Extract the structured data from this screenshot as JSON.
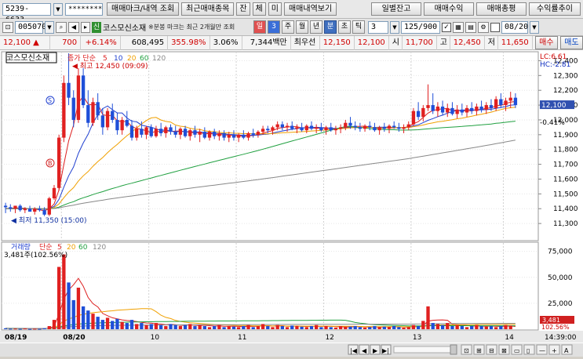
{
  "toolbar": {
    "account": "5239-6633",
    "password": "********",
    "buttons": [
      "매매마크/내역 조회",
      "최근매매종목",
      "잔",
      "체",
      "미",
      "매매내역보기"
    ],
    "right_buttons": [
      "일별잔고",
      "매매수익",
      "매매총평",
      "수익률추이"
    ]
  },
  "toolbar2": {
    "code": "005070",
    "name_tag": "신",
    "stock_name": "코스모신소재",
    "notice": "※분봉 마크는 최근 2개월만 조회",
    "periods": [
      "일",
      "3",
      "주",
      "월",
      "년",
      "분",
      "초",
      "틱"
    ],
    "selected_period": "분",
    "minute_value": "3",
    "count": "125/900",
    "date": "08/20"
  },
  "quote": {
    "price": "12,100",
    "change": "700",
    "change_pct": "+6.14%",
    "volume": "608,495",
    "vol_ratio": "355.98%",
    "turnover_pct": "3.06%",
    "amount": "7,344백만",
    "best_label": "최우선",
    "best_ask": "12,150",
    "best_bid": "12,100",
    "open_label": "시",
    "open": "11,700",
    "high_label": "고",
    "high": "12,450",
    "low_label": "저",
    "low": "11,650",
    "buy_button": "매수",
    "sell_button": "매도"
  },
  "chart_data": {
    "type": "candlestick",
    "price_panel": {
      "title": "코스모신소재",
      "ma_label": "종가 단순",
      "ma_periods": [
        "5",
        "10",
        "20",
        "60",
        "120"
      ],
      "ma_colors": [
        "#dd2020",
        "#2040d0",
        "#f0a000",
        "#20a040",
        "#888888"
      ],
      "ylim": [
        11200,
        12450
      ],
      "yticks": [
        "12,400",
        "12,300",
        "12,200",
        "12,100",
        "12,000",
        "11,900",
        "11,800",
        "11,700",
        "11,600",
        "11,500",
        "11,400",
        "11,300"
      ],
      "high_annotation": "최고 12,450 (09:09)",
      "low_annotation": "최저 11,350 (15:00)",
      "current_price": "12,100",
      "lc": "LC:6.61",
      "hc": "HC:-2.81",
      "pct_label": "-0.41%",
      "marks": [
        "S",
        "B"
      ]
    },
    "volume_panel": {
      "title": "거래량",
      "ma_label": "단순",
      "ma_periods": [
        "5",
        "20",
        "60",
        "120"
      ],
      "current_label": "3,481주(102.56%)",
      "yticks": [
        "75,000",
        "50,000",
        "25,000"
      ],
      "current_value": "3,481",
      "current_pct": "102.56%"
    },
    "x_labels": [
      "08/19",
      "08/20",
      "10",
      "11",
      "12",
      "13",
      "14"
    ],
    "time_label": "14:39:00",
    "candles": [
      [
        11420,
        11440,
        11370,
        11410
      ],
      [
        11410,
        11430,
        11380,
        11400
      ],
      [
        11400,
        11420,
        11370,
        11420
      ],
      [
        11420,
        11430,
        11380,
        11390
      ],
      [
        11390,
        11410,
        11370,
        11400
      ],
      [
        11400,
        11420,
        11380,
        11380
      ],
      [
        11380,
        11410,
        11360,
        11400
      ],
      [
        11400,
        11420,
        11380,
        11390
      ],
      [
        11390,
        11410,
        11350,
        11360
      ],
      [
        11360,
        11480,
        11350,
        11470
      ],
      [
        11470,
        11560,
        11460,
        11540
      ],
      [
        11540,
        11900,
        11520,
        11880
      ],
      [
        11880,
        12300,
        11850,
        12250
      ],
      [
        12250,
        12450,
        12100,
        12150
      ],
      [
        12150,
        12200,
        11950,
        12000
      ],
      [
        12000,
        12350,
        11980,
        12300
      ],
      [
        12300,
        12350,
        12080,
        12100
      ],
      [
        12100,
        12200,
        11950,
        11980
      ],
      [
        11980,
        12150,
        11960,
        12120
      ],
      [
        12120,
        12180,
        12000,
        12030
      ],
      [
        12030,
        12080,
        11900,
        11950
      ],
      [
        11950,
        12080,
        11930,
        12060
      ],
      [
        12060,
        12110,
        11980,
        12000
      ],
      [
        12000,
        12050,
        11900,
        11930
      ],
      [
        11930,
        12020,
        11900,
        12000
      ],
      [
        12000,
        12060,
        11950,
        11960
      ],
      [
        11960,
        12000,
        11860,
        11880
      ],
      [
        11880,
        11960,
        11860,
        11940
      ],
      [
        11940,
        11990,
        11880,
        11900
      ],
      [
        11900,
        11960,
        11870,
        11950
      ],
      [
        11950,
        11970,
        11880,
        11890
      ],
      [
        11890,
        11960,
        11880,
        11940
      ],
      [
        11940,
        11980,
        11890,
        11910
      ],
      [
        11910,
        11960,
        11880,
        11950
      ],
      [
        11950,
        11970,
        11900,
        11920
      ],
      [
        11920,
        11960,
        11880,
        11900
      ],
      [
        11900,
        11950,
        11870,
        11940
      ],
      [
        11940,
        11960,
        11880,
        11890
      ],
      [
        11890,
        11940,
        11860,
        11930
      ],
      [
        11930,
        11960,
        11880,
        11900
      ],
      [
        11900,
        11940,
        11850,
        11920
      ],
      [
        11920,
        11950,
        11870,
        11880
      ],
      [
        11880,
        11930,
        11860,
        11920
      ],
      [
        11920,
        11940,
        11870,
        11890
      ],
      [
        11890,
        11930,
        11860,
        11910
      ],
      [
        11910,
        11930,
        11860,
        11880
      ],
      [
        11880,
        11920,
        11850,
        11900
      ],
      [
        11900,
        11930,
        11860,
        11880
      ],
      [
        11880,
        11910,
        11850,
        11900
      ],
      [
        11900,
        11930,
        11870,
        11880
      ],
      [
        11880,
        11920,
        11860,
        11910
      ],
      [
        11910,
        11940,
        11880,
        11900
      ],
      [
        11900,
        11930,
        11880,
        11920
      ],
      [
        11920,
        11960,
        11900,
        11940
      ],
      [
        11940,
        11960,
        11910,
        11930
      ],
      [
        11930,
        11960,
        11900,
        11950
      ],
      [
        11950,
        11990,
        11930,
        11970
      ],
      [
        11970,
        11990,
        11930,
        11950
      ],
      [
        11950,
        11980,
        11920,
        11960
      ],
      [
        11960,
        11990,
        11930,
        11940
      ],
      [
        11940,
        11970,
        11910,
        11950
      ],
      [
        11950,
        11980,
        11920,
        11930
      ],
      [
        11930,
        11970,
        11910,
        11960
      ],
      [
        11960,
        11990,
        11930,
        11940
      ],
      [
        11940,
        11970,
        11910,
        11950
      ],
      [
        11950,
        11980,
        11920,
        11930
      ],
      [
        11930,
        11960,
        11900,
        11950
      ],
      [
        11950,
        11980,
        11920,
        11930
      ],
      [
        11930,
        11960,
        11900,
        11940
      ],
      [
        11940,
        11970,
        11910,
        11950
      ],
      [
        11950,
        12000,
        11930,
        11980
      ],
      [
        11980,
        12020,
        11940,
        11960
      ],
      [
        11960,
        11990,
        11930,
        11950
      ],
      [
        11950,
        11980,
        11920,
        11940
      ],
      [
        11940,
        11970,
        11920,
        11960
      ],
      [
        11960,
        11990,
        11930,
        11950
      ],
      [
        11950,
        11980,
        11920,
        11930
      ],
      [
        11930,
        11960,
        11900,
        11950
      ],
      [
        11950,
        11980,
        11920,
        11940
      ],
      [
        11940,
        11970,
        11910,
        11960
      ],
      [
        11960,
        11990,
        11940,
        11950
      ],
      [
        11950,
        11980,
        11920,
        11940
      ],
      [
        11940,
        11970,
        11910,
        11950
      ],
      [
        11950,
        11990,
        11930,
        11970
      ],
      [
        11970,
        12080,
        11960,
        12060
      ],
      [
        12060,
        12120,
        12000,
        12020
      ],
      [
        12020,
        12100,
        11990,
        12080
      ],
      [
        12080,
        12240,
        12060,
        12100
      ],
      [
        12100,
        12180,
        12040,
        12060
      ],
      [
        12060,
        12120,
        12020,
        12090
      ],
      [
        12090,
        12130,
        12030,
        12050
      ],
      [
        12050,
        12110,
        12020,
        12080
      ],
      [
        12080,
        12120,
        12030,
        12040
      ],
      [
        12040,
        12100,
        12010,
        12070
      ],
      [
        12070,
        12110,
        12030,
        12050
      ],
      [
        12050,
        12100,
        12020,
        12080
      ],
      [
        12080,
        12120,
        12040,
        12060
      ],
      [
        12060,
        12110,
        12030,
        12090
      ],
      [
        12090,
        12130,
        12050,
        12070
      ],
      [
        12070,
        12120,
        12040,
        12100
      ],
      [
        12100,
        12140,
        12060,
        12080
      ],
      [
        12080,
        12160,
        12060,
        12140
      ],
      [
        12140,
        12180,
        12080,
        12100
      ],
      [
        12100,
        12150,
        12060,
        12130
      ],
      [
        12130,
        12190,
        12080,
        12150
      ],
      [
        12150,
        12180,
        12080,
        12100
      ]
    ],
    "volumes": [
      900,
      500,
      600,
      400,
      700,
      300,
      500,
      400,
      900,
      3000,
      9000,
      60000,
      72000,
      45000,
      28000,
      40000,
      22000,
      18000,
      15000,
      12000,
      9000,
      11000,
      8000,
      10000,
      7000,
      6000,
      9000,
      5000,
      6000,
      4000,
      5000,
      6000,
      4000,
      3000,
      5000,
      4000,
      3000,
      4000,
      5000,
      3000,
      4000,
      3000,
      2000,
      3000,
      4000,
      2000,
      3000,
      2500,
      2000,
      3000,
      4000,
      2000,
      3000,
      5000,
      3000,
      2000,
      4000,
      3000,
      2000,
      3500,
      3000,
      2500,
      2000,
      3000,
      4000,
      2000,
      3000,
      2000,
      1500,
      3000,
      2000,
      2500,
      3000,
      2000,
      1500,
      2000,
      3000,
      2000,
      2500,
      2000,
      3000,
      2000,
      1500,
      2000,
      4000,
      3000,
      8000,
      22000,
      6000,
      5000,
      4000,
      6000,
      3000,
      4000,
      3000,
      2000,
      3000,
      4000,
      3000,
      2500,
      3000,
      2000,
      3000,
      4000,
      3481
    ]
  }
}
